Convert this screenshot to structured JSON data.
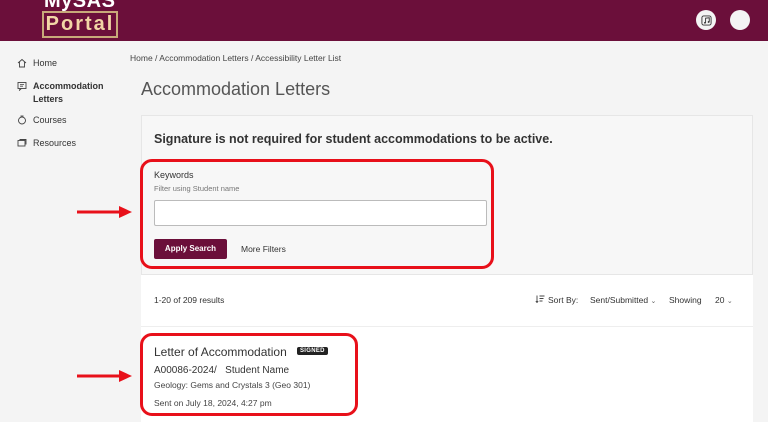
{
  "header": {
    "logo_top": "MySAS",
    "logo_bottom": "Portal",
    "brand_color": "#6b0f3a"
  },
  "sidebar": {
    "items": [
      {
        "label": "Home",
        "icon": "home-icon"
      },
      {
        "label": "Accommodation Letters",
        "icon": "letter-icon"
      },
      {
        "label": "Courses",
        "icon": "courses-icon"
      },
      {
        "label": "Resources",
        "icon": "resources-icon"
      }
    ]
  },
  "breadcrumb": "Home / Accommodation Letters / Accessibility Letter List",
  "page_title": "Accommodation Letters",
  "search_card": {
    "notice": "Signature is not required for student accommodations to be active.",
    "keywords_label": "Keywords",
    "keywords_hint": "Filter using Student name",
    "keywords_value": "",
    "apply_label": "Apply Search",
    "more_filters_label": "More Filters"
  },
  "results": {
    "count_text": "1-20 of 209 results",
    "sort_label": "Sort By:",
    "sort_value": "Sent/Submitted",
    "showing_label": "Showing",
    "showing_value": "20"
  },
  "letter": {
    "title": "Letter of Accommodation",
    "badge": "SIGNED",
    "id_line": "A00086-2024/   Student Name",
    "course": "Geology: Gems and Crystals 3 (Geo 301)",
    "sent": "Sent on July 18, 2024, 4:27 pm"
  },
  "annotation_color": "#e8101a"
}
